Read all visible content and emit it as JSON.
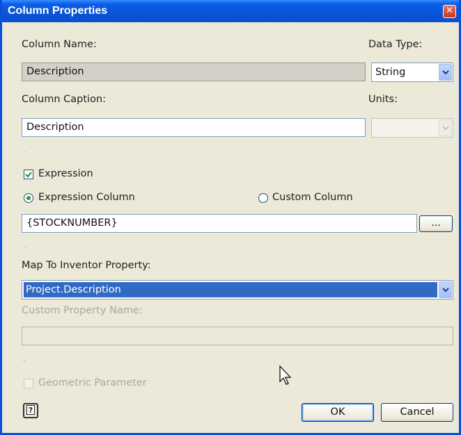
{
  "window": {
    "title": "Column Properties",
    "close": "✕"
  },
  "column_name": {
    "label": "Column Name:",
    "value": "Description"
  },
  "data_type": {
    "label": "Data Type:",
    "value": "String"
  },
  "column_caption": {
    "label": "Column Caption:",
    "value": "Description"
  },
  "units": {
    "label": "Units:",
    "value": ""
  },
  "expression": {
    "checkbox_label": "Expression",
    "checked": true,
    "radio_expression_label": "Expression Column",
    "radio_custom_label": "Custom Column",
    "selected": "expression",
    "value": "{STOCKNUMBER}",
    "browse_label": "..."
  },
  "map_property": {
    "label": "Map To Inventor Property:",
    "value": "Project.Description"
  },
  "custom_property": {
    "label": "Custom Property Name:",
    "value": ""
  },
  "geometric": {
    "label": "Geometric Parameter",
    "checked": false
  },
  "buttons": {
    "help": "?",
    "ok": "OK",
    "cancel": "Cancel"
  }
}
